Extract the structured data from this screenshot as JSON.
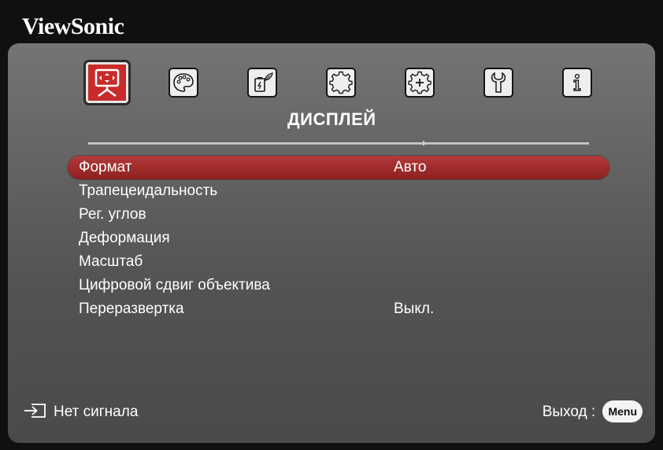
{
  "brand": "ViewSonic",
  "colors": {
    "accent_red": "#c82b2b",
    "selection_red": "#a22d2d",
    "panel_gray": "#626262",
    "background": "#101010",
    "text": "#ffffff"
  },
  "tabs": [
    {
      "icon": "projector-screen-icon",
      "active": true
    },
    {
      "icon": "palette-icon",
      "active": false
    },
    {
      "icon": "battery-leaf-icon",
      "active": false
    },
    {
      "icon": "gear-icon",
      "active": false
    },
    {
      "icon": "gear-plus-icon",
      "active": false
    },
    {
      "icon": "wrench-icon",
      "active": false
    },
    {
      "icon": "info-icon",
      "active": false
    }
  ],
  "section_title": "ДИСПЛЕЙ",
  "menu": {
    "items": [
      {
        "label": "Формат",
        "value": "Авто",
        "selected": true
      },
      {
        "label": "Трапецеидальность",
        "value": ""
      },
      {
        "label": "Рег. углов",
        "value": ""
      },
      {
        "label": "Деформация",
        "value": ""
      },
      {
        "label": "Масштаб",
        "value": ""
      },
      {
        "label": "Цифровой сдвиг объектива",
        "value": ""
      },
      {
        "label": "Переразвертка",
        "value": "Выкл."
      }
    ]
  },
  "footer": {
    "input_icon": "input-source-icon",
    "status": "Нет сигнала",
    "exit_label": "Выход :",
    "menu_key": "Menu"
  }
}
